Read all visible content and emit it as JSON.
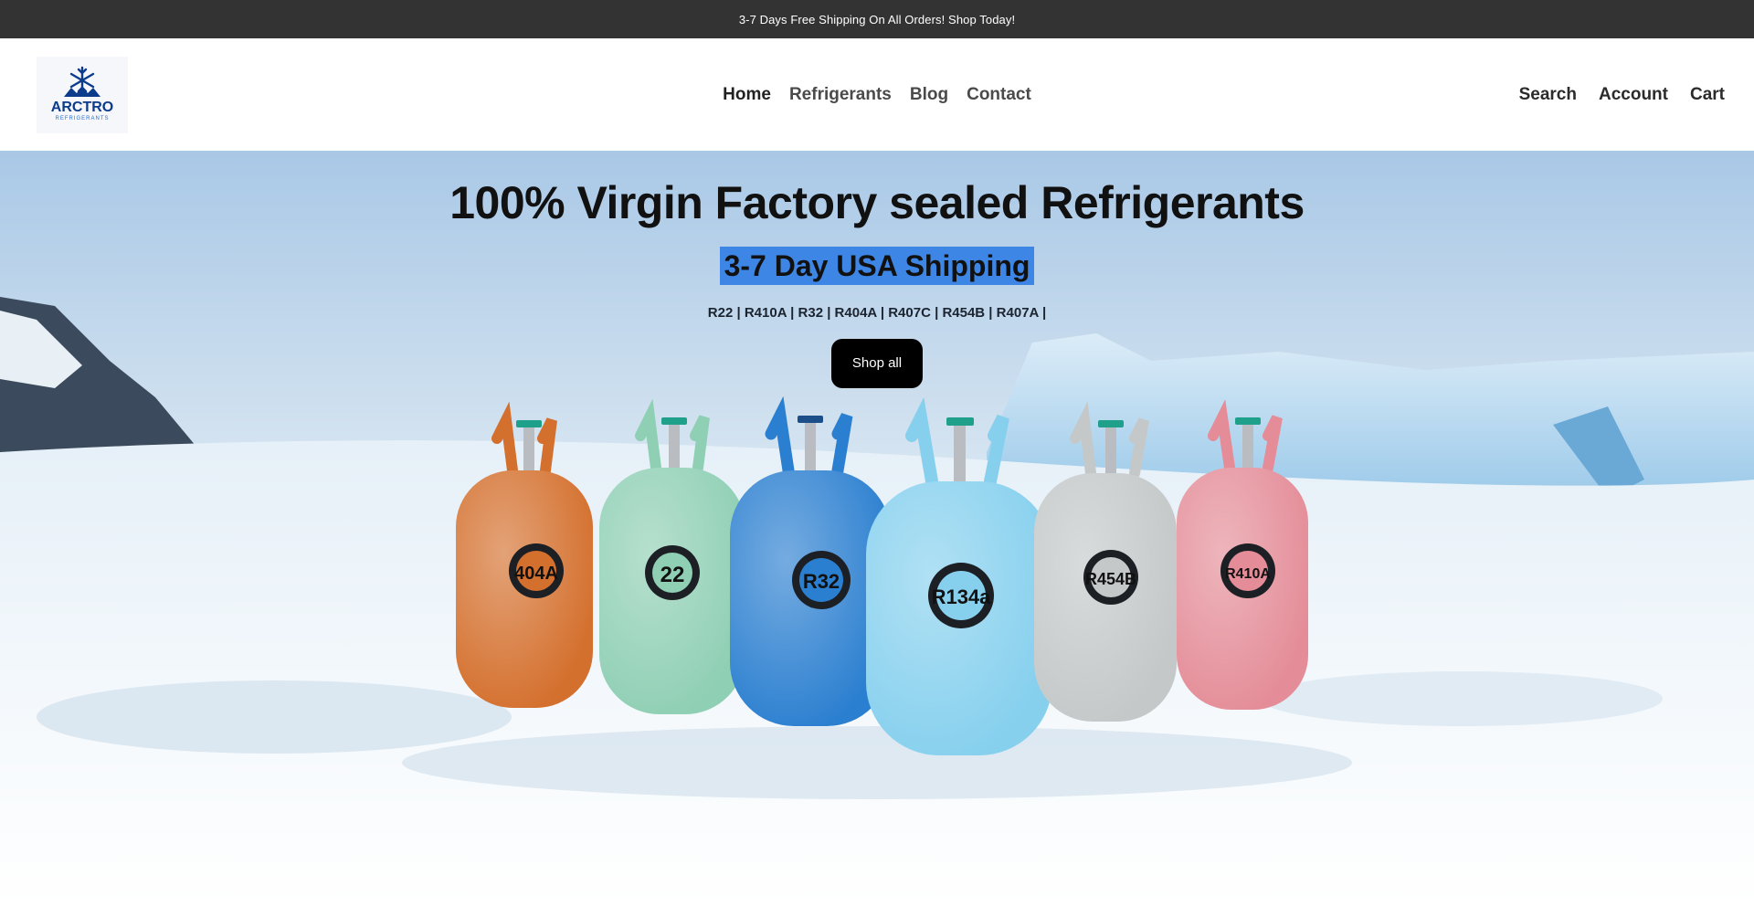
{
  "announcement": {
    "text": "3-7 Days Free Shipping On All Orders! Shop Today!"
  },
  "logo": {
    "name": "ARCTRO",
    "tagline": "REFRIGERANTS",
    "color": "#0d3b8c"
  },
  "nav": {
    "items": [
      {
        "label": "Home"
      },
      {
        "label": "Refrigerants"
      },
      {
        "label": "Blog"
      },
      {
        "label": "Contact"
      }
    ]
  },
  "utilities": {
    "search": "Search",
    "account": "Account",
    "cart": "Cart"
  },
  "hero": {
    "title": "100% Virgin Factory sealed Refrigerants",
    "subtitle": "3-7 Day USA Shipping",
    "product_list": "R22 | R410A | R32 | R404A | R407C | R454B | R407A |",
    "button": "Shop all",
    "highlight_color": "#3d86e6"
  },
  "cylinders": [
    {
      "label": "404A",
      "color": "#d4702e"
    },
    {
      "label": "22",
      "color": "#8fcfb4"
    },
    {
      "label": "R32",
      "color": "#2b7fd0"
    },
    {
      "label": "R134a",
      "color": "#86d0ee"
    },
    {
      "label": "R454B",
      "color": "#c4c8c9"
    },
    {
      "label": "R410A",
      "color": "#e48d98"
    }
  ]
}
